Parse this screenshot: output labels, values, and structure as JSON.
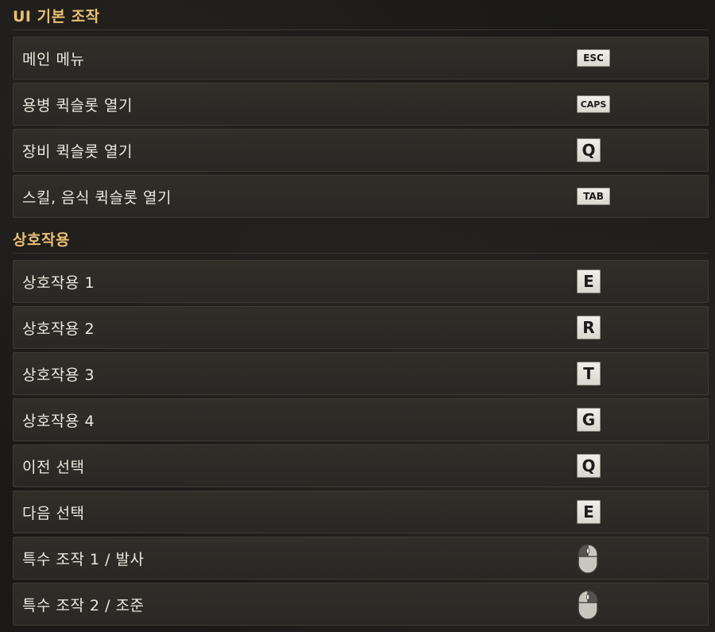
{
  "sections": [
    {
      "title": "UI 기본 조작",
      "rows": [
        {
          "label": "메인 메뉴",
          "key": "ESC",
          "key_style": "wide"
        },
        {
          "label": "용병 퀵슬롯 열기",
          "key": "CAPS",
          "key_style": "wide"
        },
        {
          "label": "장비 퀵슬롯 열기",
          "key": "Q",
          "key_style": "square"
        },
        {
          "label": "스킬, 음식 퀵슬롯 열기",
          "key": "TAB",
          "key_style": "wide"
        }
      ]
    },
    {
      "title": "상호작용",
      "rows": [
        {
          "label": "상호작용 1",
          "key": "E",
          "key_style": "square"
        },
        {
          "label": "상호작용 2",
          "key": "R",
          "key_style": "square"
        },
        {
          "label": "상호작용 3",
          "key": "T",
          "key_style": "square"
        },
        {
          "label": "상호작용 4",
          "key": "G",
          "key_style": "square"
        },
        {
          "label": "이전 선택",
          "key": "Q",
          "key_style": "square"
        },
        {
          "label": "다음 선택",
          "key": "E",
          "key_style": "square"
        },
        {
          "label": "특수 조작 1 / 발사",
          "key_icon": "mouse-left-click-icon"
        },
        {
          "label": "특수 조작 2 / 조준",
          "key_icon": "mouse-right-click-icon"
        }
      ]
    }
  ],
  "colors": {
    "section_title": "#e9bf73",
    "row_bg": "#2d2b27",
    "label_text": "#ece8df",
    "keycap_bg": "#e6e3dc"
  }
}
